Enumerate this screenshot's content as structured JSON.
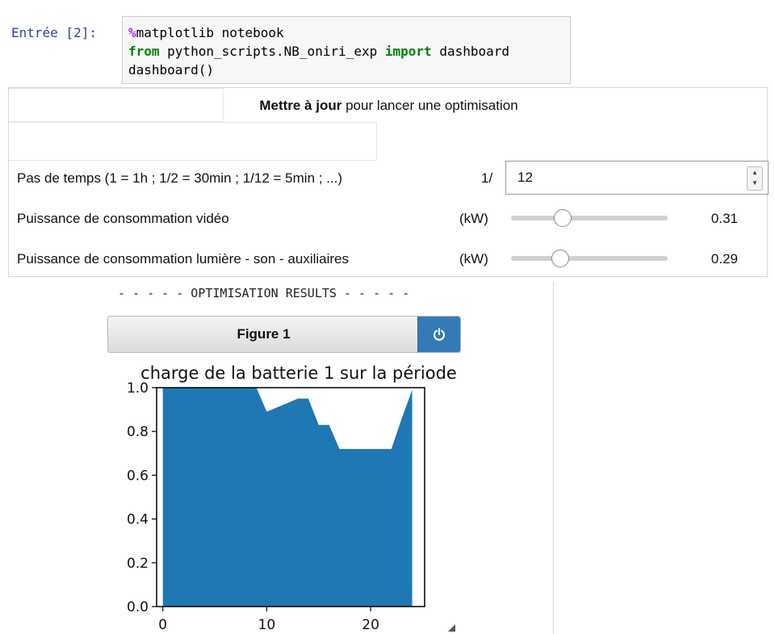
{
  "cell": {
    "prompt": "Entrée [2]:",
    "code": {
      "line1_magic": "%",
      "line1_rest": "matplotlib notebook",
      "line2_from": "from",
      "line2_module": " python_scripts.NB_oniri_exp ",
      "line2_import": "import",
      "line2_name": " dashboard",
      "line3": "dashboard()"
    }
  },
  "panel": {
    "header_bold": "Mettre à jour",
    "header_rest": " pour lancer une optimisation",
    "step": {
      "label": "Pas de temps (1 = 1h ; 1/2 = 30min ; 1/12 = 5min ; ...)",
      "prefix": "1/",
      "value": "12"
    },
    "video": {
      "label": "Puissance de consommation vidéo",
      "unit": "(kW)",
      "value": "0.31",
      "level": 0.31
    },
    "light": {
      "label": "Puissance de consommation lumière - son - auxiliaires",
      "unit": "(kW)",
      "value": "0.29",
      "level": 0.29
    }
  },
  "output": {
    "results_line": "- - - - - OPTIMISATION RESULTS - - - - -",
    "figure_title": "Figure 1",
    "colors": {
      "accent": "#337ab7",
      "series": "#1f77b4"
    }
  },
  "chart_data": {
    "type": "area",
    "title": "charge de la batterie 1 sur la période",
    "xlabel": "",
    "ylabel": "",
    "xlim": [
      -0.6,
      25.2
    ],
    "ylim": [
      0.0,
      1.0
    ],
    "xticks": [
      0,
      10,
      20
    ],
    "yticks": [
      0.0,
      0.2,
      0.4,
      0.6,
      0.8,
      1.0
    ],
    "xtick_labels": [
      "0",
      "10",
      "20"
    ],
    "ytick_labels": [
      "0.0",
      "0.2",
      "0.4",
      "0.6",
      "0.8",
      "1.0"
    ],
    "grid": false,
    "series": [
      {
        "x": [
          0,
          1,
          2,
          3,
          4,
          5,
          6,
          7,
          8,
          9,
          10,
          11,
          12,
          13,
          14,
          15,
          16,
          17,
          18,
          19,
          20,
          21,
          22,
          23,
          24
        ],
        "y": [
          1.0,
          1.0,
          1.0,
          1.0,
          1.0,
          1.0,
          1.0,
          1.0,
          1.0,
          1.0,
          0.89,
          0.91,
          0.93,
          0.95,
          0.95,
          0.83,
          0.83,
          0.72,
          0.72,
          0.72,
          0.72,
          0.72,
          0.72,
          0.86,
          0.99
        ]
      }
    ]
  }
}
